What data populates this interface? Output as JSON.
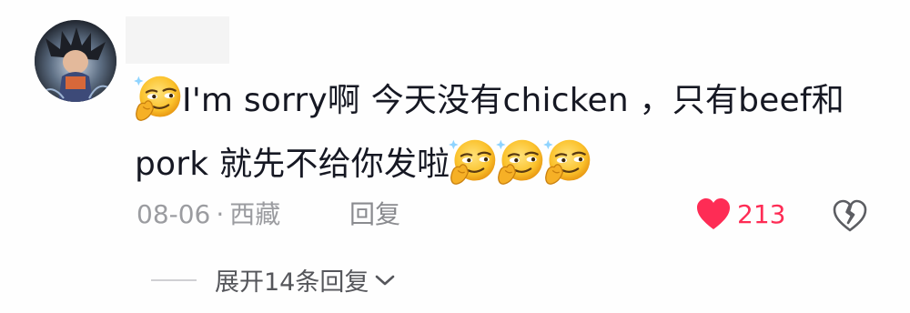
{
  "comment": {
    "avatar_icon": "avatar-image",
    "text_line1_part1": "I'm sorry啊  今天没有chicken ，只有beef和",
    "text_line2_part1": "pork  就先不给你发啦",
    "emoji_name": "smirk-emoji",
    "emoji_count_line2": 3,
    "date": "08-06",
    "separator": "·",
    "location": "西藏",
    "reply_label": "回复",
    "like_count": "213",
    "like_color": "#fe2c55",
    "expand_label": "展开14条回复"
  }
}
